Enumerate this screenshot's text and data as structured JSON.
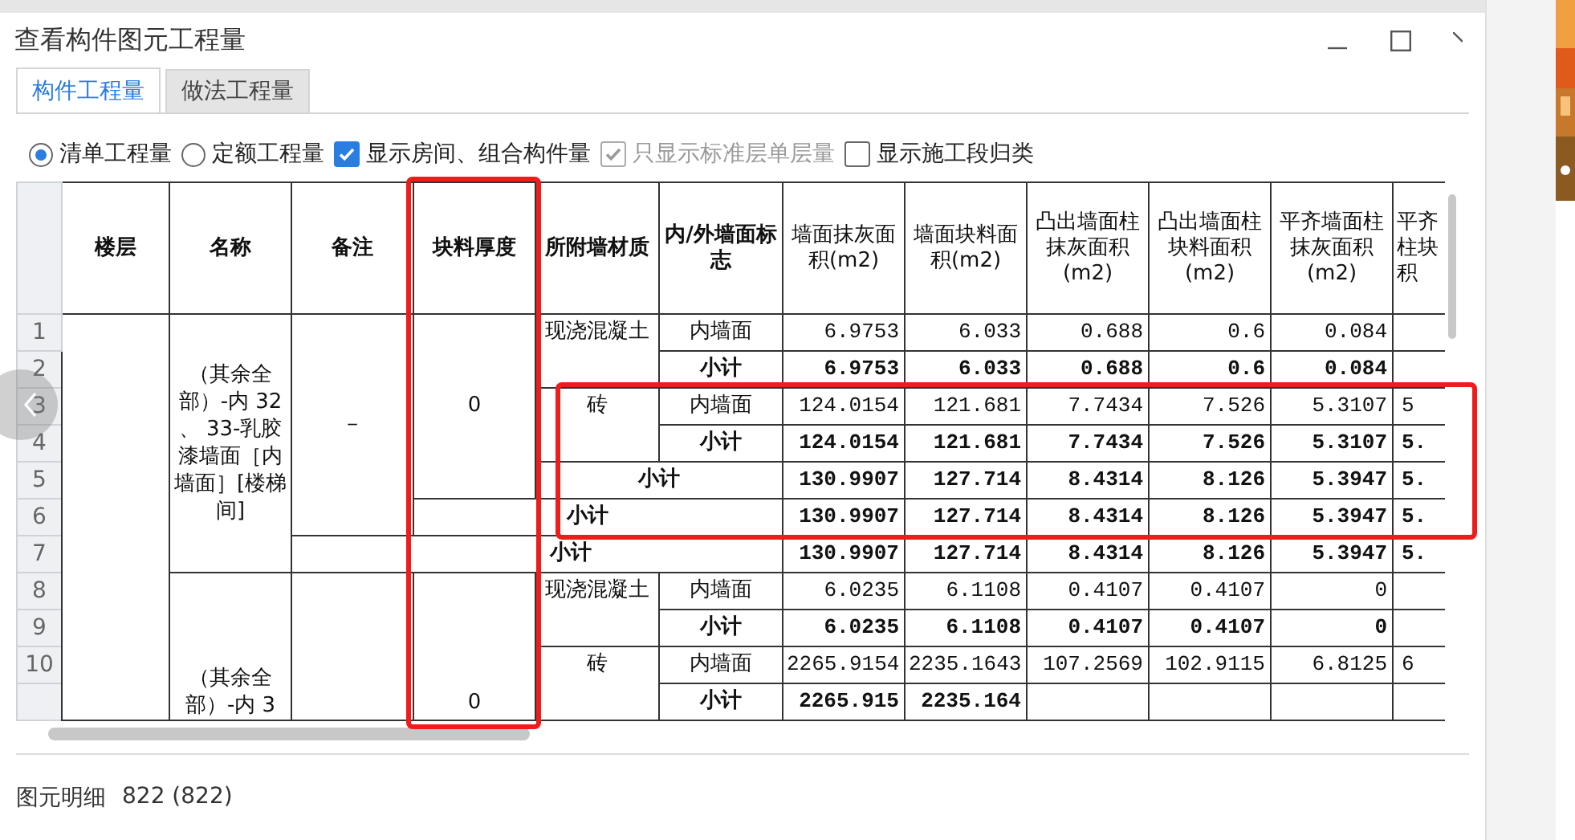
{
  "window": {
    "title": "查看构件图元工程量"
  },
  "tabs": [
    {
      "label": "构件工程量",
      "selected": true
    },
    {
      "label": "做法工程量",
      "selected": false
    }
  ],
  "options": [
    {
      "kind": "radio",
      "label": "清单工程量",
      "checked": true,
      "disabled": false
    },
    {
      "kind": "radio",
      "label": "定额工程量",
      "checked": false,
      "disabled": false
    },
    {
      "kind": "checkbox",
      "label": "显示房间、组合构件量",
      "checked": true,
      "disabled": false
    },
    {
      "kind": "checkbox",
      "label": "只显示标准层单层量",
      "checked": true,
      "disabled": true
    },
    {
      "kind": "checkbox",
      "label": "显示施工段归类",
      "checked": false,
      "disabled": false
    }
  ],
  "table": {
    "columns": [
      "楼层",
      "名称",
      "备注",
      "块料厚度",
      "所附墙材质",
      "内/外墙面标志",
      "墙面抹灰面积(m2)",
      "墙面块料面积(m2)",
      "凸出墙面柱抹灰面积(m2)",
      "凸出墙面柱块料面积(m2)",
      "平齐墙面柱抹灰面积(m2)",
      "平齐柱块积"
    ],
    "row_numbers": [
      "1",
      "2",
      "3",
      "4",
      "5",
      "6",
      "7",
      "8",
      "9",
      "10"
    ],
    "groups": [
      {
        "name": "（其余全部）-内 32 、 33-乳胶漆墙面［内墙面］[楼梯间]",
        "remark": "－",
        "thickness": "0",
        "materials": [
          {
            "material": "现浇混凝土",
            "rows": [
              {
                "kind": "detail",
                "label": "内墙面",
                "values": [
                  "6.9753",
                  "6.033",
                  "0.688",
                  "0.6",
                  "0.084"
                ]
              },
              {
                "kind": "subtotal",
                "label": "小计",
                "values": [
                  "6.9753",
                  "6.033",
                  "0.688",
                  "0.6",
                  "0.084"
                ]
              }
            ]
          },
          {
            "material": "砖",
            "rows": [
              {
                "kind": "detail",
                "label": "内墙面",
                "values": [
                  "124.0154",
                  "121.681",
                  "7.7434",
                  "7.526",
                  "5.3107",
                  "5"
                ]
              },
              {
                "kind": "subtotal",
                "label": "小计",
                "values": [
                  "124.0154",
                  "121.681",
                  "7.7434",
                  "7.526",
                  "5.3107",
                  "5."
                ]
              }
            ]
          }
        ],
        "material_total": {
          "label": "小计",
          "values": [
            "130.9907",
            "127.714",
            "8.4314",
            "8.126",
            "5.3947",
            "5."
          ]
        },
        "thickness_total": {
          "label": "小计",
          "values": [
            "130.9907",
            "127.714",
            "8.4314",
            "8.126",
            "5.3947",
            "5."
          ]
        },
        "group_total": {
          "label": "小计",
          "values": [
            "130.9907",
            "127.714",
            "8.4314",
            "8.126",
            "5.3947",
            "5."
          ]
        }
      },
      {
        "name": "（其余全部）-内 3",
        "thickness": "0",
        "materials": [
          {
            "material": "现浇混凝土",
            "rows": [
              {
                "kind": "detail",
                "label": "内墙面",
                "values": [
                  "6.0235",
                  "6.1108",
                  "0.4107",
                  "0.4107",
                  "0"
                ]
              },
              {
                "kind": "subtotal",
                "label": "小计",
                "values": [
                  "6.0235",
                  "6.1108",
                  "0.4107",
                  "0.4107",
                  "0"
                ]
              }
            ]
          },
          {
            "material": "砖",
            "rows": [
              {
                "kind": "detail",
                "label": "内墙面",
                "values": [
                  "2265.9154",
                  "2235.1643",
                  "107.2569",
                  "102.9115",
                  "6.8125",
                  "6"
                ]
              },
              {
                "kind": "subtotal",
                "label": "小计",
                "values": [
                  "2265.915",
                  "2235.164"
                ]
              }
            ]
          }
        ]
      }
    ]
  },
  "annotations": {
    "thickness_column_box": true,
    "rows_box": true
  },
  "status_bar": {
    "label": "图元明细",
    "count": "822 (822)"
  }
}
